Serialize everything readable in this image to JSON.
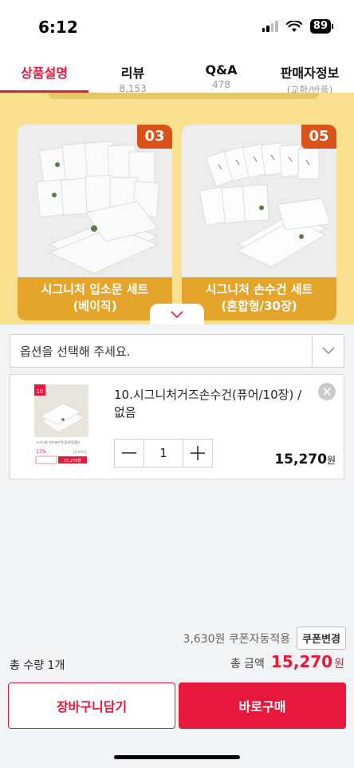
{
  "status_bar": {
    "time": "6:12",
    "battery": "89"
  },
  "tabs": [
    {
      "label": "상품설명",
      "sub": ""
    },
    {
      "label": "리뷰",
      "sub": "8,153"
    },
    {
      "label": "Q&A",
      "sub": "478"
    },
    {
      "label": "판매자정보",
      "sub": "(교환/반품)"
    }
  ],
  "banner": {
    "cards": [
      {
        "number": "03",
        "caption_line1": "시그니처 입소문 세트",
        "caption_line2": "(베이직)"
      },
      {
        "number": "05",
        "caption_line1": "시그니처 손수건 세트",
        "caption_line2": "(혼합형/30장)"
      }
    ]
  },
  "option_select": {
    "placeholder": "옵션을 선택해 주세요."
  },
  "selected_item": {
    "name": "10.시그니처거즈손수건(퓨어/10장) / 없음",
    "quantity": "1",
    "price": "15,270",
    "price_unit": "원",
    "thumb": {
      "badge": "10",
      "product_name": "시그니처 거즈손수건(퓨어/10장)",
      "discount": "17%",
      "original_price": "18,900원",
      "sale_price": "15,270원"
    }
  },
  "coupon": {
    "text": "3,630원 쿠폰자동적용",
    "button": "쿠폰변경"
  },
  "totals": {
    "quantity": "총 수량 1개",
    "label": "총 금액",
    "price": "15,270",
    "unit": "원"
  },
  "actions": {
    "cart": "장바구니담기",
    "buy": "바로구매"
  },
  "colors": {
    "accent": "#e8183d",
    "banner": "#f8e08e",
    "caption": "#e5a42a",
    "badge": "#d9521a"
  }
}
